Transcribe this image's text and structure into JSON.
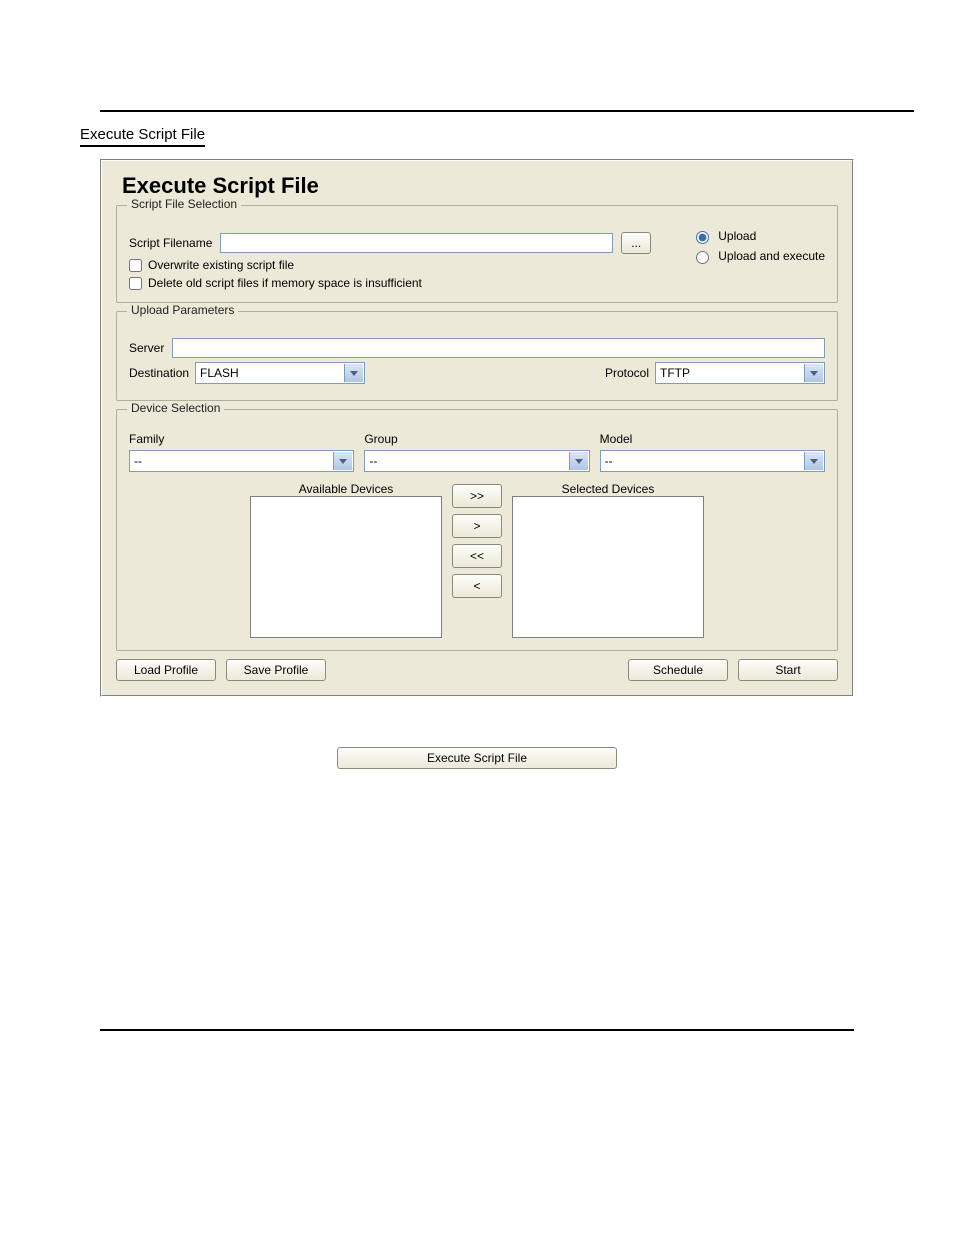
{
  "section_heading": "Execute Script File",
  "app": {
    "title": "Execute Script File",
    "script_selection": {
      "legend": "Script File Selection",
      "filename_label": "Script Filename",
      "filename_value": "",
      "browse_label": "...",
      "overwrite_label": "Overwrite existing script file",
      "overwrite_checked": false,
      "delete_old_label": "Delete old script files if memory space is insufficient",
      "delete_old_checked": false,
      "mode": {
        "upload_label": "Upload",
        "upload_execute_label": "Upload and execute",
        "selected": "upload"
      }
    },
    "upload_parameters": {
      "legend": "Upload Parameters",
      "server_label": "Server",
      "server_value": "",
      "destination_label": "Destination",
      "destination_value": "FLASH",
      "protocol_label": "Protocol",
      "protocol_value": "TFTP"
    },
    "device_selection": {
      "legend": "Device Selection",
      "family_label": "Family",
      "family_value": "--",
      "group_label": "Group",
      "group_value": "--",
      "model_label": "Model",
      "model_value": "--",
      "available_label": "Available Devices",
      "selected_label": "Selected Devices",
      "available_devices": [],
      "selected_devices": [],
      "move_all_right": ">>",
      "move_right": ">",
      "move_all_left": "<<",
      "move_left": "<"
    },
    "footer": {
      "load_profile": "Load Profile",
      "save_profile": "Save Profile",
      "schedule": "Schedule",
      "start": "Start"
    }
  },
  "standalone_button": "Execute Script File"
}
